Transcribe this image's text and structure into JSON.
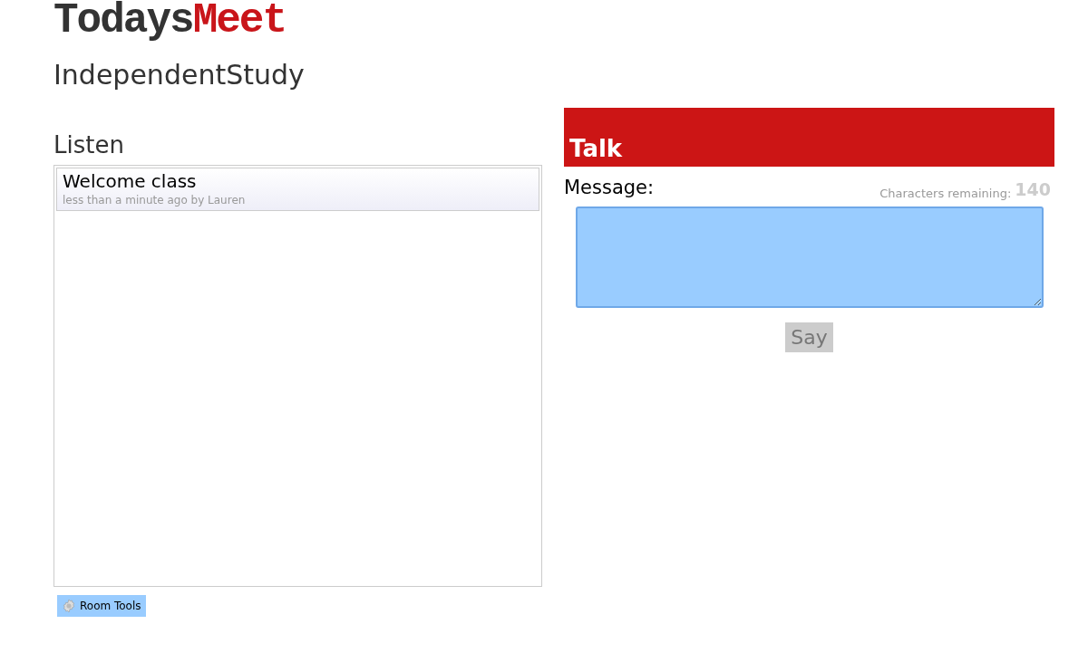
{
  "logo": {
    "first": "Todays",
    "second": "Meet"
  },
  "room_title": "IndependentStudy",
  "listen": {
    "heading": "Listen",
    "messages": [
      {
        "text": "Welcome class",
        "meta": "less than a minute ago by Lauren"
      }
    ]
  },
  "room_tools": {
    "label": "Room Tools"
  },
  "talk": {
    "heading": "Talk",
    "message_label": "Message:",
    "chars_label": "Characters remaining:",
    "chars_count": "140",
    "say_button": {
      "label": "Say",
      "disabled": true
    }
  }
}
